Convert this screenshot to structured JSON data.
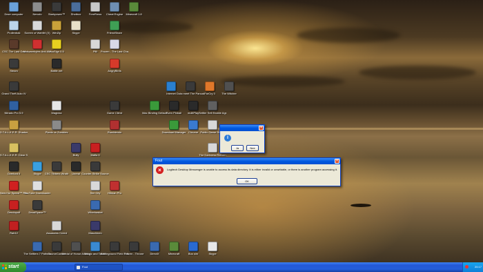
{
  "desktop_icons": [
    {
      "label": "Deze computer",
      "color": "#6aa0d8"
    },
    {
      "label": "Nerodo",
      "color": "#8c8c8c"
    },
    {
      "label": "Starkpower™",
      "color": "#3a3a3a"
    },
    {
      "label": "Shotbox",
      "color": "#4b6d9a"
    },
    {
      "label": "FreeRmss",
      "color": "#c8c8c8"
    },
    {
      "label": "Cheat Engine",
      "color": "#6f8fb3"
    },
    {
      "label": "Minecraft 1.8",
      "color": "#5a8a3a"
    },
    {
      "label": "Prullenbak",
      "color": "#bcd4ea"
    },
    {
      "label": "Screen of Wahfet (X)",
      "color": "#d9d9d9"
    },
    {
      "label": "WinZip",
      "color": "#c9a13a"
    },
    {
      "label": "Skype",
      "color": "#e8e0c8"
    },
    {
      "label": "FriendShare",
      "color": "#3f9e55"
    },
    {
      "label": "CSC The Last Gen",
      "color": "#5a3a2a"
    },
    {
      "label": "Malwarebytes Anti-Malware",
      "color": "#d03030"
    },
    {
      "label": "YouSign 0.5",
      "color": "#e8d020"
    },
    {
      "label": "Pilli",
      "color": "#d8d8d8"
    },
    {
      "label": "Frozen - The Last Chapter",
      "color": "#d8d8e8"
    },
    {
      "label": "Steam",
      "color": "#3a3a3a"
    },
    {
      "label": "Battle.net",
      "color": "#2a2a2a"
    },
    {
      "label": "AngryBirds",
      "color": "#d63a2a"
    },
    {
      "label": "Grand Theft Auto IV",
      "color": "#3a3a3a"
    },
    {
      "label": "Internet",
      "color": "#2a80d0"
    },
    {
      "label": "Dota meet The Pancakes",
      "color": "#3a3a3a"
    },
    {
      "label": "FarCry 3",
      "color": "#e0782a"
    },
    {
      "label": "The Witcher",
      "color": "#505050"
    },
    {
      "label": "Nitrado Pro 5.9",
      "color": "#3060a0"
    },
    {
      "label": "Magicka",
      "color": "#e6e6e6"
    },
    {
      "label": "Game Client",
      "color": "#3a3a3a"
    },
    {
      "label": "Mac Binding Default",
      "color": "#3a9a3a"
    },
    {
      "label": "Sven Pinball",
      "color": "#2a2a2a"
    },
    {
      "label": "multiPlay",
      "color": "#2a2a2a"
    },
    {
      "label": "Settler Sell Enable Agent",
      "color": "#606060"
    },
    {
      "label": "S.T.A.L.K.E.R. Shadow of Chernobyl",
      "color": "#c8a040"
    },
    {
      "label": "Plants vs Zombies",
      "color": "#8a8a8a"
    },
    {
      "label": "Rumblemin",
      "color": "#b03030"
    },
    {
      "label": "Download Manager",
      "color": "#3a9a3a"
    },
    {
      "label": "Chrome",
      "color": "#3a7ad0"
    },
    {
      "label": "Public Game Studio",
      "color": "#d8d8d8"
    },
    {
      "label": "S.T.A.L.K.E.R. Clear Sky",
      "color": "#d8c060"
    },
    {
      "label": "Bully",
      "color": "#3a3a6a"
    },
    {
      "label": "Mafia II",
      "color": "#c82020"
    },
    {
      "label": "The Darkness Reborn",
      "color": "#d8d8d8"
    },
    {
      "label": "Overlord II",
      "color": "#2a2a2a"
    },
    {
      "label": "Skype",
      "color": "#3aa0e0"
    },
    {
      "label": "CSC Tibbers Wrath",
      "color": "#3a3a3a"
    },
    {
      "label": "Unreal",
      "color": "#2a2a2a"
    },
    {
      "label": "Counter-Strike Source",
      "color": "#3a3a3a"
    },
    {
      "label": "Need for Speed™ Rivals",
      "color": "#d02020"
    },
    {
      "label": "YouTube Downloader",
      "color": "#e0e0e0"
    },
    {
      "label": "Dendopolf",
      "color": "#c82020"
    },
    {
      "label": "DeadSpace™",
      "color": "#3a3a3a"
    },
    {
      "label": "Wherbasket",
      "color": "#3a6ab0"
    },
    {
      "label": "Rab12",
      "color": "#c02020"
    },
    {
      "label": "Assassins Creed",
      "color": "#d8d8d8"
    },
    {
      "label": "Maschinen",
      "color": "#3a3a6a"
    },
    {
      "label": "The Settlers 7 Paths to a Kingdom",
      "color": "#3a6ab0"
    },
    {
      "label": "SourceControl",
      "color": "#3a3a3a"
    },
    {
      "label": "Medal of Honor Allied Assault",
      "color": "#505050"
    },
    {
      "label": "Magic and Tactic",
      "color": "#3a8ad0"
    },
    {
      "label": "Battleground Field Edition",
      "color": "#3a3a3a"
    },
    {
      "label": "Frozen - Throne",
      "color": "#3a3a3a"
    },
    {
      "label": "DirectX",
      "color": "#3a6ab0"
    },
    {
      "label": "Minecraft",
      "color": "#5a8a3a"
    },
    {
      "label": "Bus sim",
      "color": "#2a6ad0"
    },
    {
      "label": "Skype",
      "color": "#e8e8e8"
    },
    {
      "label": "Sim City",
      "color": "#d8d8d8"
    },
    {
      "label": "Hitman Pro",
      "color": "#c03030"
    }
  ],
  "question_dialog": {
    "icon": "info-icon",
    "yes_label": "Ja",
    "no_label": "Nee"
  },
  "error_dialog": {
    "title": "Fout",
    "icon": "error-icon",
    "message": "Logitech Desktop Messenger is unable to access its data directory. It is either invalid or unwritable, or there is another program accessing it.",
    "ok_label": "OK"
  },
  "taskbar": {
    "start_label": "start",
    "task_label": "Fout",
    "clock": "20:17"
  }
}
